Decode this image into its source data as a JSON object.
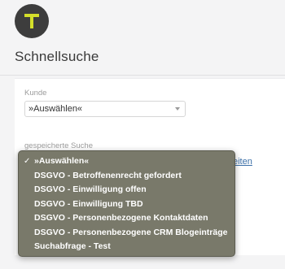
{
  "header": {
    "avatar_letter": "T",
    "avatar_bg": "#3d3d3d",
    "avatar_letter_color": "#d4df2a",
    "title": "Schnellsuche"
  },
  "form": {
    "kunde_label": "Kunde",
    "kunde_value": "»Auswählen«",
    "suche_label": "gespeicherte Suche",
    "link_text_partial": "eiten"
  },
  "dropdown": {
    "selected_index": 0,
    "items": [
      "»Auswählen«",
      "DSGVO - Betroffenenrecht gefordert",
      "DSGVO - Einwilligung offen",
      "DSGVO - Einwilligung TBD",
      "DSGVO - Personenbezogene Kontaktdaten",
      "DSGVO - Personenbezogene CRM Blogeinträge",
      "Suchabfrage - Test"
    ],
    "check_glyph": "✓",
    "menu_bg": "#747464"
  }
}
